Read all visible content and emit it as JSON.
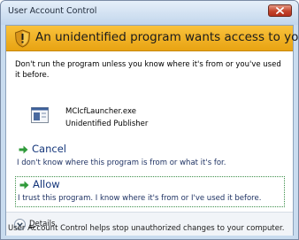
{
  "window": {
    "title": "User Account Control"
  },
  "banner": {
    "text": "An unidentified program wants access to your computer"
  },
  "warning": {
    "text": "Don't run the program unless you know where it's from or you've used it before."
  },
  "program": {
    "name": "MCIcfLauncher.exe",
    "publisher": "Unidentified Publisher"
  },
  "options": {
    "cancel": {
      "title": "Cancel",
      "description": "I don't know where this program is from or what it's for."
    },
    "allow": {
      "title": "Allow",
      "description": "I trust this program. I know where it's from or I've used it before."
    }
  },
  "details": {
    "label_first": "D",
    "label_rest": "etails"
  },
  "footer": {
    "text": "User Account Control helps stop unauthorized changes to your computer."
  },
  "colors": {
    "banner": "#f3b62a",
    "option_text": "#14367a",
    "arrow": "#2f9a3a"
  },
  "icons": {
    "close": "close-icon",
    "shield": "shield-warning-icon",
    "program": "program-icon",
    "arrow": "green-arrow-icon",
    "details": "chevron-down-icon"
  }
}
